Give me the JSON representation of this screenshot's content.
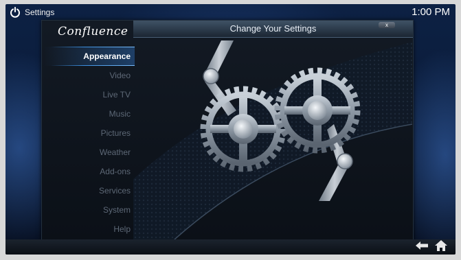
{
  "topbar": {
    "title": "Settings",
    "clock": "1:00 PM"
  },
  "panel": {
    "title": "Change Your Settings",
    "close_label": "x"
  },
  "logo": "Confluence",
  "menu": {
    "items": [
      {
        "label": "Appearance",
        "active": true
      },
      {
        "label": "Video"
      },
      {
        "label": "Live TV"
      },
      {
        "label": "Music"
      },
      {
        "label": "Pictures"
      },
      {
        "label": "Weather"
      },
      {
        "label": "Add-ons"
      },
      {
        "label": "Services"
      },
      {
        "label": "System"
      },
      {
        "label": "Help"
      }
    ]
  },
  "footer": {
    "icons": [
      "back-arrow-icon",
      "home-icon"
    ]
  },
  "colors": {
    "accent": "#3b8fe0",
    "background": "#0d2144"
  }
}
